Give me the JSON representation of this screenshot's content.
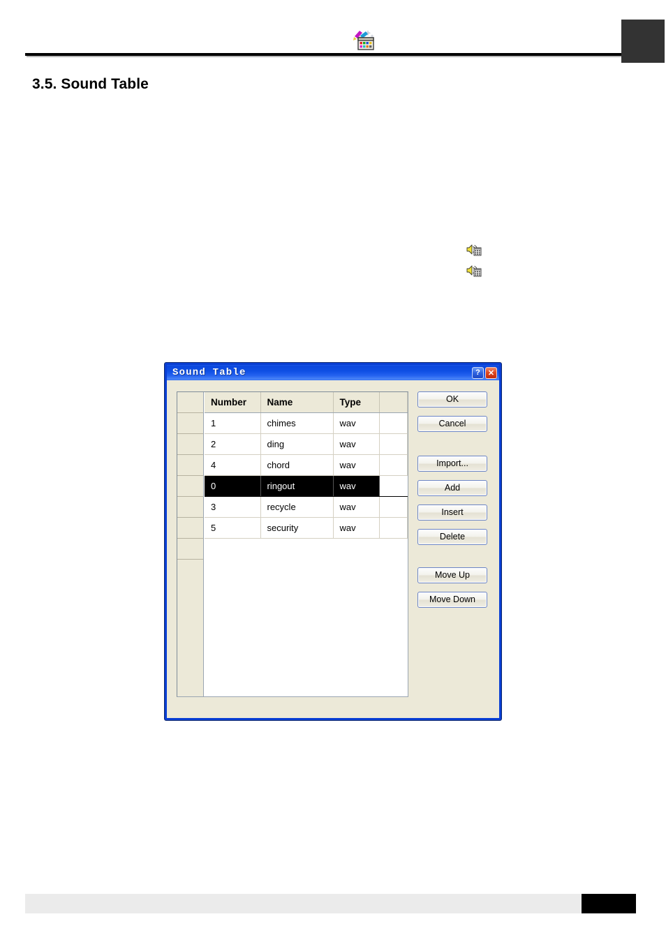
{
  "page": {
    "section_number_title": "3.5. Sound Table",
    "header_logo_icon": "paint-palette-grid-icon",
    "header_black_box": "black-corner-box",
    "footer_black_box": "black-footer-box"
  },
  "inline_icons": [
    {
      "name": "sound-table-icon-1",
      "icon": "speaker-table-icon"
    },
    {
      "name": "sound-table-icon-2",
      "icon": "speaker-table-icon"
    }
  ],
  "dialog": {
    "title": "Sound Table",
    "help_button": "?",
    "close_button": "✕",
    "table": {
      "columns": [
        "Number",
        "Name",
        "Type"
      ],
      "rows": [
        {
          "number": "1",
          "name": "chimes",
          "type": "wav",
          "selected": false
        },
        {
          "number": "2",
          "name": "ding",
          "type": "wav",
          "selected": false
        },
        {
          "number": "4",
          "name": "chord",
          "type": "wav",
          "selected": false
        },
        {
          "number": "0",
          "name": "ringout",
          "type": "wav",
          "selected": true
        },
        {
          "number": "3",
          "name": "recycle",
          "type": "wav",
          "selected": false
        },
        {
          "number": "5",
          "name": "security",
          "type": "wav",
          "selected": false
        }
      ]
    },
    "buttons": {
      "ok": "OK",
      "cancel": "Cancel",
      "import": "Import...",
      "add": "Add",
      "insert": "Insert",
      "delete": "Delete",
      "move_up": "Move Up",
      "move_down": "Move Down"
    }
  },
  "colors": {
    "titlebar_blue": "#0f4fe4",
    "dialog_border": "#0a3fd4",
    "dialog_face": "#ece9d8",
    "selection": "#000000",
    "header_box": "#333333"
  }
}
